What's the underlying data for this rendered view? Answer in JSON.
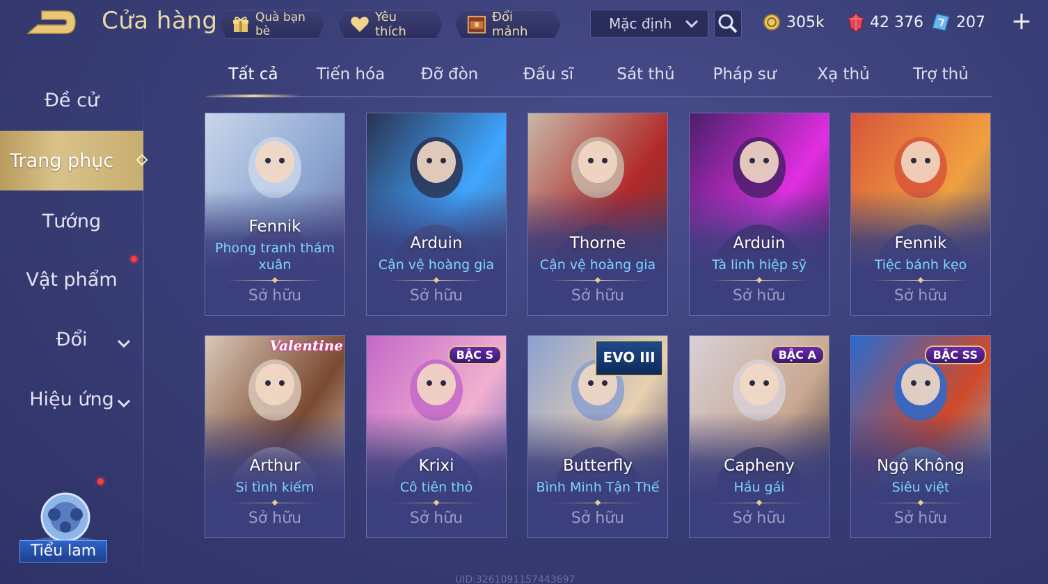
{
  "header": {
    "title": "Cửa hàng",
    "gift_friends": "Quà bạn bè",
    "favorites": "Yêu thích",
    "exchange_shards": "Đổi mảnh",
    "sort_value": "Mặc định",
    "currencies": [
      {
        "icon": "gold-coin-icon",
        "value": "305k"
      },
      {
        "icon": "ruby-gem-icon",
        "value": "42 376"
      },
      {
        "icon": "voucher-card-icon",
        "value": "207"
      }
    ],
    "add_button": "+"
  },
  "sidebar": {
    "items": [
      {
        "label": "Đề cử"
      },
      {
        "label": "Trang phục"
      },
      {
        "label": "Tướng"
      },
      {
        "label": "Vật phẩm"
      },
      {
        "label": "Đổi"
      },
      {
        "label": "Hiệu ứng"
      }
    ],
    "pet_label": "Tiểu lam"
  },
  "tabs": [
    "Tất cả",
    "Tiến hóa",
    "Đỡ đòn",
    "Đấu sĩ",
    "Sát thủ",
    "Pháp sư",
    "Xạ thủ",
    "Trợ thủ"
  ],
  "active_tab": "Tất cả",
  "cards": [
    {
      "hero": "Fennik",
      "skin": "Phong tranh thám xuân",
      "status": "Sở hữu",
      "badge": "",
      "colors": [
        "#c9d6ea",
        "#8aa4cf",
        "#6e5a8a"
      ]
    },
    {
      "hero": "Arduin",
      "skin": "Cận vệ hoàng gia",
      "status": "Sở hữu",
      "badge": "",
      "colors": [
        "#2a3350",
        "#3fa6ff",
        "#545a72"
      ]
    },
    {
      "hero": "Thorne",
      "skin": "Cận vệ hoàng gia",
      "status": "Sở hữu",
      "badge": "",
      "colors": [
        "#c8b8a8",
        "#b12a2a",
        "#5a3a3a"
      ]
    },
    {
      "hero": "Arduin",
      "skin": "Tà linh hiệp sỹ",
      "status": "Sở hữu",
      "badge": "",
      "colors": [
        "#4a1f6a",
        "#e22ee2",
        "#2a1840"
      ]
    },
    {
      "hero": "Fennik",
      "skin": "Tiệc bánh kẹo",
      "status": "Sở hữu",
      "badge": "",
      "colors": [
        "#d8553a",
        "#f0a040",
        "#3a4a8a"
      ]
    },
    {
      "hero": "Arthur",
      "skin": "Si tình kiếm",
      "status": "Sở hữu",
      "badge": "Valentine",
      "colors": [
        "#d9c7b8",
        "#7a4a30",
        "#f2ece6"
      ]
    },
    {
      "hero": "Krixi",
      "skin": "Cô tiên thỏ",
      "status": "Sở hữu",
      "badge": "BẬC S",
      "colors": [
        "#c468c8",
        "#f0b0d0",
        "#5050b0"
      ]
    },
    {
      "hero": "Butterfly",
      "skin": "Bình Minh Tận Thế",
      "status": "Sở hữu",
      "badge": "EVO III",
      "colors": [
        "#8aa0d0",
        "#e8d0b0",
        "#303060"
      ]
    },
    {
      "hero": "Capheny",
      "skin": "Hầu gái",
      "status": "Sở hữu",
      "badge": "BẬC A",
      "colors": [
        "#d8d0d8",
        "#c8a890",
        "#202030"
      ]
    },
    {
      "hero": "Ngộ Không",
      "skin": "Siêu việt",
      "status": "Sở hữu",
      "badge": "BẬC SS",
      "colors": [
        "#2a6ad0",
        "#d04a2a",
        "#60d0ff"
      ]
    }
  ],
  "uid": "UID:3261091157443697"
}
